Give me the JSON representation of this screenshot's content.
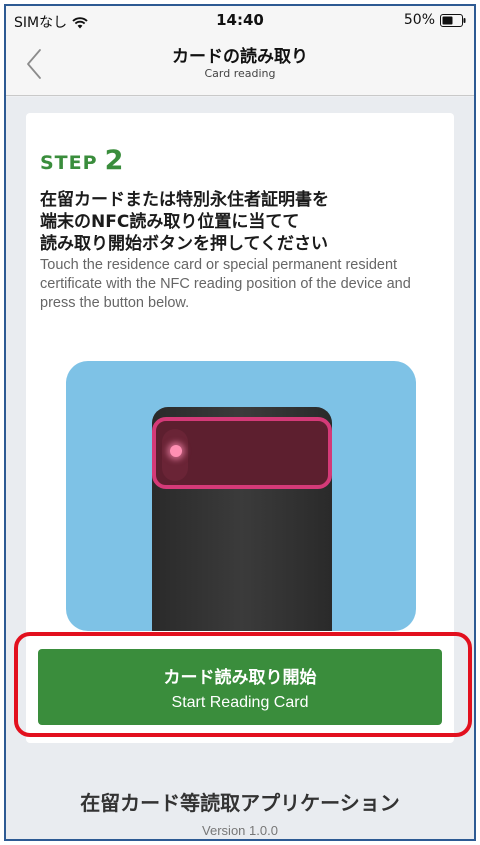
{
  "status_bar": {
    "carrier": "SIMなし",
    "time": "14:40",
    "battery": "50%",
    "icons": [
      "wifi-icon",
      "battery-icon"
    ]
  },
  "nav": {
    "title": "カードの読み取り",
    "subtitle": "Card reading",
    "back_icon": "chevron-left-icon"
  },
  "step": {
    "label": "STEP",
    "number": "2",
    "instruction_jp": "在留カードまたは特別永住者証明書を\n端末のNFC読み取り位置に当てて\n読み取り開始ボタンを押してください",
    "instruction_en": "Touch the residence card or special permanent resident certificate with the NFC reading position of the device and press the button below."
  },
  "button": {
    "label_jp": "カード読み取り開始",
    "label_en": "Start Reading Card"
  },
  "footer": {
    "app_name": "在留カード等読取アプリケーション",
    "version": "Version 1.0.0"
  },
  "colors": {
    "accent_green": "#3a8d3c",
    "highlight_red": "#e2101e",
    "illustration_blue": "#7ec2e6",
    "nfc_pink": "#d43a78"
  }
}
